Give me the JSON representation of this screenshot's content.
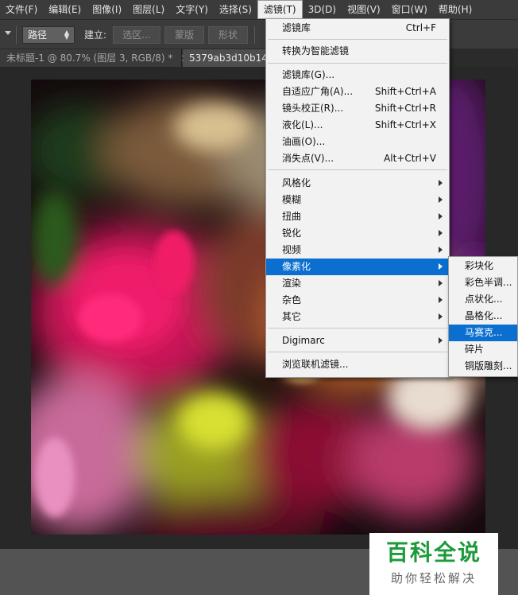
{
  "menubar": {
    "items": [
      "文件(F)",
      "编辑(E)",
      "图像(I)",
      "图层(L)",
      "文字(Y)",
      "选择(S)",
      "滤镜(T)",
      "3D(D)",
      "视图(V)",
      "窗口(W)",
      "帮助(H)"
    ],
    "active_index": 6
  },
  "options_bar": {
    "mode_select": "路径",
    "make_label": "建立:",
    "selection_button": "选区...",
    "mask_button": "蒙版",
    "shape_button": "形状"
  },
  "tabs": [
    {
      "label": "未标题-1 @ 80.7% (图层 3, RGB/8) *",
      "close": "×"
    },
    {
      "label": "5379ab3d10b14."
    }
  ],
  "filter_menu": {
    "items": [
      {
        "label": "滤镜库",
        "shortcut": "Ctrl+F"
      },
      {
        "label": "转换为智能滤镜"
      },
      {
        "label": "滤镜库(G)..."
      },
      {
        "label": "自适应广角(A)...",
        "shortcut": "Shift+Ctrl+A"
      },
      {
        "label": "镜头校正(R)...",
        "shortcut": "Shift+Ctrl+R"
      },
      {
        "label": "液化(L)...",
        "shortcut": "Shift+Ctrl+X"
      },
      {
        "label": "油画(O)..."
      },
      {
        "label": "消失点(V)...",
        "shortcut": "Alt+Ctrl+V"
      },
      {
        "label": "风格化"
      },
      {
        "label": "模糊"
      },
      {
        "label": "扭曲"
      },
      {
        "label": "锐化"
      },
      {
        "label": "视频"
      },
      {
        "label": "像素化"
      },
      {
        "label": "渲染"
      },
      {
        "label": "杂色"
      },
      {
        "label": "其它"
      },
      {
        "label": "Digimarc"
      },
      {
        "label": "浏览联机滤镜..."
      }
    ],
    "highlighted": "像素化"
  },
  "pixelate_submenu": {
    "items": [
      "彩块化",
      "彩色半调...",
      "点状化...",
      "晶格化...",
      "马赛克...",
      "碎片",
      "铜版雕刻..."
    ],
    "highlighted": "马赛克..."
  },
  "watermark": {
    "title": "百科全说",
    "subtitle": "助你轻松解决"
  },
  "colors": {
    "highlight": "#0b6fd0",
    "menu_bg": "#f2f2f2",
    "ui_dark": "#3b3b3b",
    "watermark_green": "#1d9b3b"
  }
}
